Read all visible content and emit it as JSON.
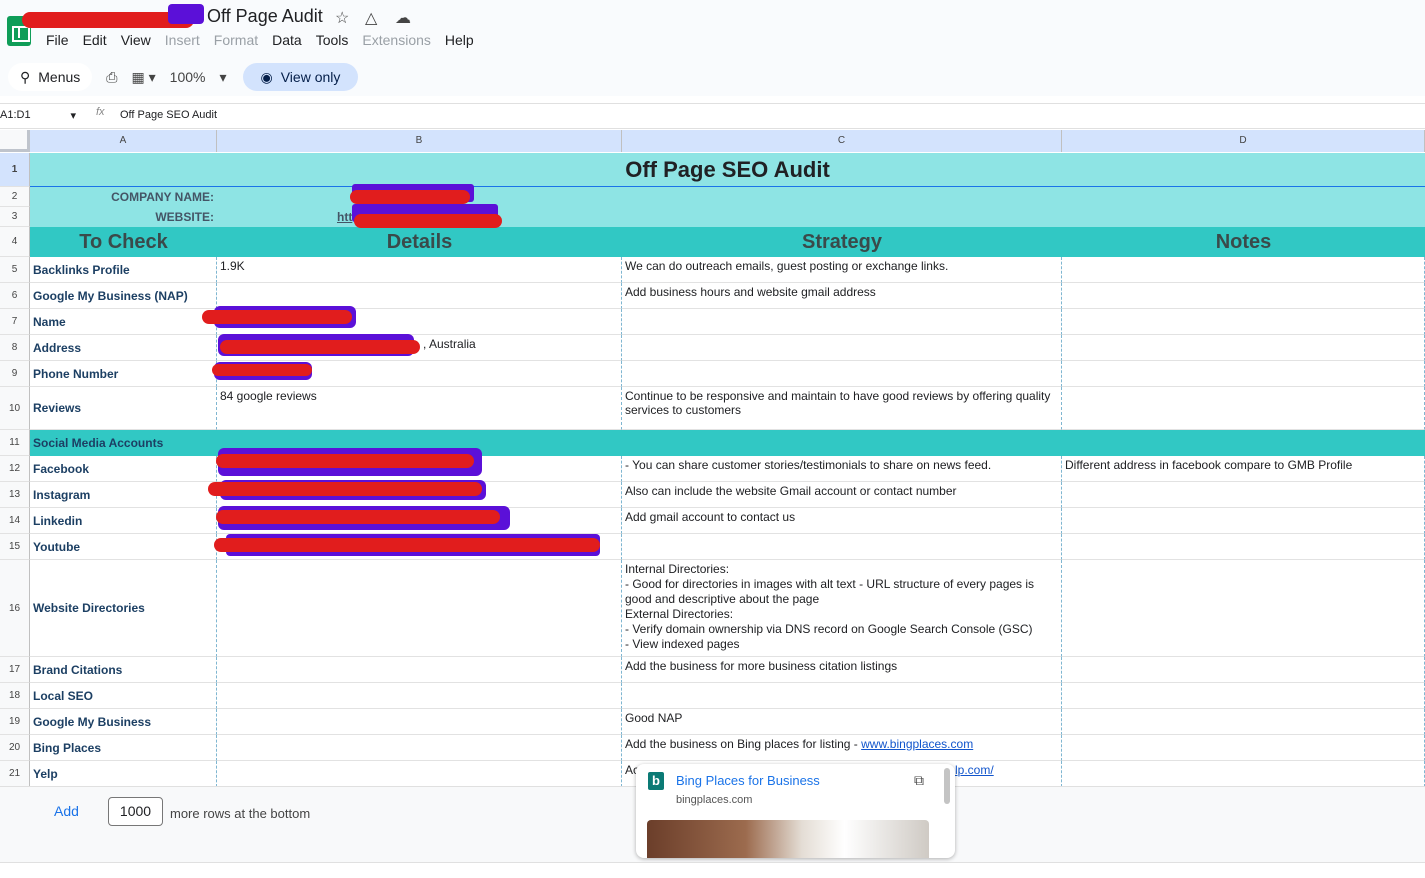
{
  "window": {
    "doc_title": "Off Page Audit",
    "menus": [
      "File",
      "Edit",
      "View",
      "Insert",
      "Format",
      "Data",
      "Tools",
      "Extensions",
      "Help"
    ],
    "disabled_menus": [
      "Insert",
      "Format",
      "Extensions"
    ]
  },
  "toolbar": {
    "menus_label": "Menus",
    "zoom": "100%",
    "view_only_label": "View only"
  },
  "formula_bar": {
    "name_box": "A1:D1",
    "content": "Off Page SEO Audit"
  },
  "columns": [
    "A",
    "B",
    "C",
    "D"
  ],
  "sheet": {
    "title": "Off Page SEO Audit",
    "company_label": "COMPANY NAME:",
    "website_label": "WEBSITE:",
    "website_visible_prefix": "htt",
    "headers": [
      "To Check",
      "Details",
      "Strategy",
      "Notes"
    ],
    "rows": [
      {
        "num": "5",
        "a": "Backlinks Profile",
        "b": "1.9K",
        "c": "We can do outreach emails, guest posting or exchange links.",
        "d": ""
      },
      {
        "num": "6",
        "a": "Google My Business (NAP)",
        "b": "",
        "c": "Add business hours and website gmail address",
        "d": ""
      },
      {
        "num": "7",
        "a": "Name",
        "b": "",
        "c": "",
        "d": ""
      },
      {
        "num": "8",
        "a": "Address",
        "b": ", Australia",
        "c": "",
        "d": ""
      },
      {
        "num": "9",
        "a": "Phone Number",
        "b": "",
        "c": "",
        "d": ""
      },
      {
        "num": "10",
        "a": "Reviews",
        "b": "84 google reviews",
        "c": "Continue to be responsive and maintain to have good reviews by offering quality services to customers",
        "d": ""
      },
      {
        "num": "12",
        "a": "Facebook",
        "b": "",
        "c": "- You can share customer stories/testimonials to share on news feed.",
        "d": "Different address in facebook compare to GMB Profile"
      },
      {
        "num": "13",
        "a": "Instagram",
        "b": "",
        "c": "Also can include the website Gmail account or contact number",
        "d": ""
      },
      {
        "num": "14",
        "a": "Linkedin",
        "b": "",
        "c": "Add gmail account to contact us",
        "d": ""
      },
      {
        "num": "15",
        "a": "Youtube",
        "b": "",
        "c": "",
        "d": ""
      },
      {
        "num": "16",
        "a": "Website Directories",
        "b": "",
        "c": "Internal Directories:\n- Good for directories in images with alt text - URL structure of every pages is good and descriptive about the page\nExternal Directories:\n- Verify domain ownership via DNS record on Google Search Console (GSC)\n- View indexed pages",
        "d": ""
      },
      {
        "num": "17",
        "a": "Brand Citations",
        "b": "",
        "c": "Add the business for more business citation listings",
        "d": ""
      },
      {
        "num": "18",
        "a": "Local SEO",
        "b": "",
        "c": "",
        "d": ""
      },
      {
        "num": "19",
        "a": "Google My Business",
        "b": "",
        "c": "Good NAP",
        "d": ""
      },
      {
        "num": "20",
        "a": "Bing Places",
        "b": "",
        "c": "Add the business on Bing places for listing - ",
        "c_link": "www.bingplaces.com",
        "d": ""
      },
      {
        "num": "21",
        "a": "Yelp",
        "b": "",
        "c": "Ac",
        "c_link_tail": "lp.com/",
        "d": ""
      }
    ],
    "section_social": "Social Media Accounts"
  },
  "bottom_bar": {
    "add_label": "Add",
    "rows_value": "1000",
    "more_rows_text": "more rows at the bottom"
  },
  "link_popup": {
    "title": "Bing Places for Business",
    "domain": "bingplaces.com"
  }
}
